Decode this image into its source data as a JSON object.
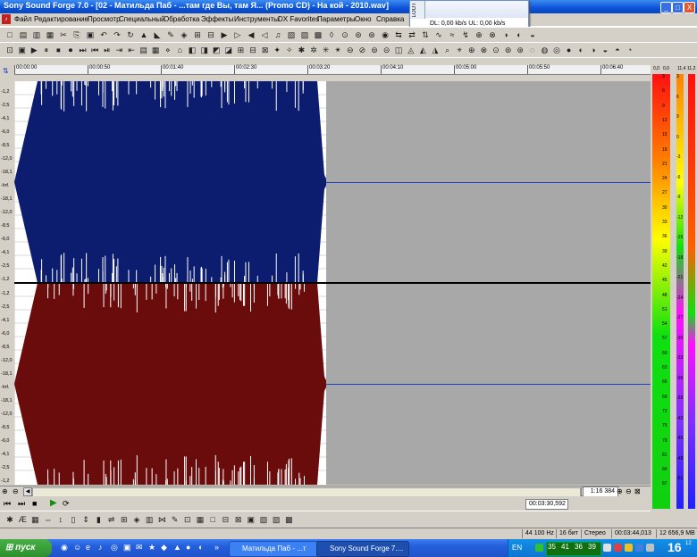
{
  "window": {
    "title": "Sony Sound Forge 7.0 - [02 - Матильда Паб - ...там где Вы, там Я... (Promo CD) - На кой - 2010.wav]",
    "controls": [
      "_",
      "□",
      "X"
    ]
  },
  "net_widget": {
    "tab_label": "LOOT",
    "stats": "DL: 0,00 kb/s   UL: 0,00 kb/s"
  },
  "menu": {
    "items": [
      "Файл",
      "Редактирование",
      "Просмотр",
      "Специальный",
      "Обработка",
      "Эффекты",
      "Инструменты",
      "DX Favorites",
      "Параметры",
      "Окно",
      "Справка"
    ]
  },
  "ruler": {
    "labels": [
      "00:00:00",
      "00:00:50",
      "00:01:40",
      "00:02:30",
      "00:03:20",
      "00:04:10",
      "00:05:00",
      "00:05:50",
      "00:06:40"
    ]
  },
  "yaxis": {
    "top_channel": [
      "-1,2",
      "-2,5",
      "-4,1",
      "-6,0",
      "-8,5",
      "-12,0",
      "-18,1",
      "-Inf.",
      "-18,1",
      "-12,0",
      "-8,5",
      "-6,0",
      "-4,1",
      "-2,5",
      "-1,2"
    ],
    "bottom_channel": [
      "-1,2",
      "-2,5",
      "-4,1",
      "-6,0",
      "-8,5",
      "-12,0",
      "-18,1",
      "-Inf.",
      "-18,1",
      "-12,0",
      "-8,5",
      "-6,0",
      "-4,1",
      "-2,5",
      "-1,2"
    ]
  },
  "meters": {
    "left_header": [
      "0,0",
      "0,0"
    ],
    "right_header": [
      "11,4",
      "11,2"
    ],
    "left_scale": [
      "3",
      "6",
      "9",
      "12",
      "15",
      "18",
      "21",
      "24",
      "27",
      "30",
      "33",
      "36",
      "39",
      "42",
      "45",
      "48",
      "51",
      "54",
      "57",
      "60",
      "63",
      "66",
      "69",
      "72",
      "75",
      "78",
      "81",
      "84",
      "87"
    ],
    "right_scale": [
      "3",
      "6",
      "9",
      "0",
      "-3",
      "-6",
      "-9",
      "-12",
      "-15",
      "-18",
      "-21",
      "-24",
      "-27",
      "-30",
      "-33",
      "-36",
      "-39",
      "-42",
      "-45",
      "-48",
      "-51"
    ],
    "colors": {
      "red": "#ff1010",
      "orange": "#ff8000",
      "yellow": "#ffff00",
      "green": "#10e010"
    }
  },
  "waveform": {
    "top_color": "#0c1c6e",
    "bottom_color": "#6a0c0c",
    "end_fraction": 0.49,
    "empty_color": "#a8a8a8"
  },
  "position": {
    "zoom": "1:16 384",
    "cursor": "00:03:30,592"
  },
  "statusbar": {
    "sample_rate": "44 100 Hz",
    "bits": "16 бит",
    "channels": "Стерео",
    "length": "00:03:44,013",
    "disk": "12 656,9 MB"
  },
  "taskbar": {
    "start": "пуск",
    "tasks": [
      "Матильда Паб - ...т",
      "Sony Sound Forge 7...."
    ],
    "language": "EN",
    "clock": "16",
    "clock_small": "12",
    "tray_numbers": [
      "35",
      "41",
      "36",
      "39"
    ]
  }
}
